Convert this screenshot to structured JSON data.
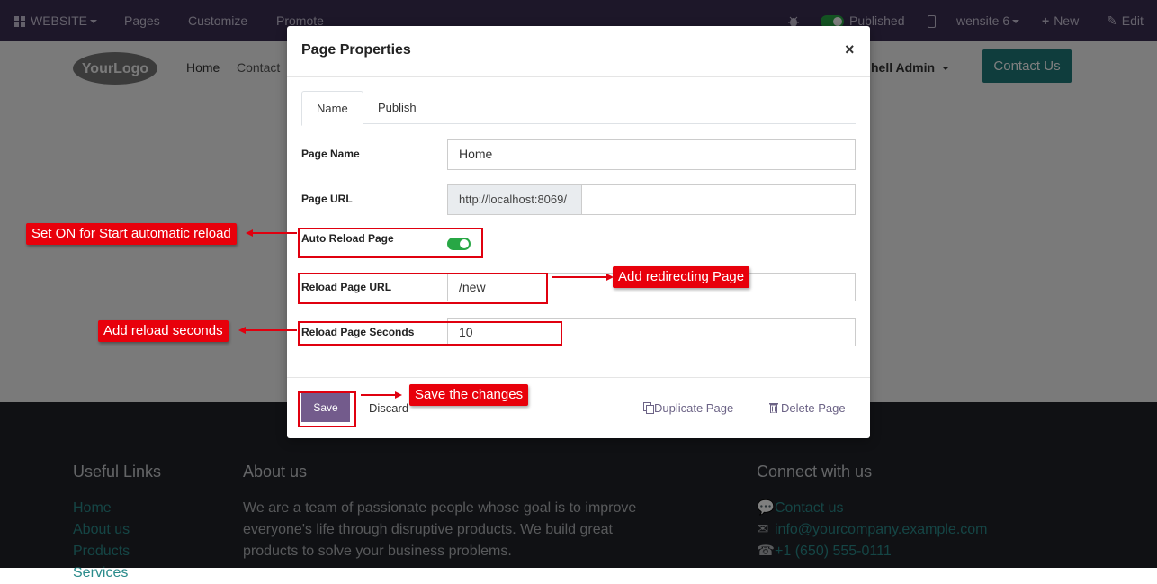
{
  "topbar": {
    "website_label": "WEBSITE",
    "pages": "Pages",
    "customize": "Customize",
    "promote": "Promote",
    "published": "Published",
    "website_select": "wensite 6",
    "new": "New",
    "edit": "Edit"
  },
  "header": {
    "logo_text": "YourLogo",
    "nav_home": "Home",
    "nav_contact": "Contact",
    "user": "hell Admin",
    "contact_button": "Contact Us",
    "accent": "#1f7a7a"
  },
  "modal": {
    "title": "Page Properties",
    "close": "×",
    "tabs": [
      "Name",
      "Publish"
    ],
    "fields": {
      "page_name_label": "Page Name",
      "page_name_value": "Home",
      "page_url_label": "Page URL",
      "page_url_prefix": "http://localhost:8069/",
      "page_url_value": "",
      "auto_reload_label": "Auto Reload Page",
      "auto_reload_on": true,
      "reload_url_label": "Reload Page URL",
      "reload_url_value": "/new",
      "reload_seconds_label": "Reload Page Seconds",
      "reload_seconds_value": "10"
    },
    "footer": {
      "save": "Save",
      "discard": "Discard",
      "duplicate": "Duplicate Page",
      "delete": "Delete Page"
    }
  },
  "annotations": {
    "auto_reload": "Set ON for Start automatic reload",
    "redirect": "Add redirecting Page",
    "seconds": "Add reload seconds",
    "save": "Save the changes"
  },
  "footer": {
    "useful_links_title": "Useful Links",
    "links": [
      "Home",
      "About us",
      "Products",
      "Services"
    ],
    "about_title": "About us",
    "about_text": "We are a team of passionate people whose goal is to improve everyone's life through disruptive products. We build great products to solve your business problems.",
    "connect_title": "Connect with us",
    "contact_link": "Contact us",
    "email": "info@yourcompany.example.com",
    "phone": "+1 (650) 555-0111"
  },
  "colors": {
    "topbar": "#3a2f52",
    "primary": "#735b8c",
    "annotation_red": "#e8000b",
    "toggle_on": "#28a745",
    "footer_bg": "#202328"
  }
}
